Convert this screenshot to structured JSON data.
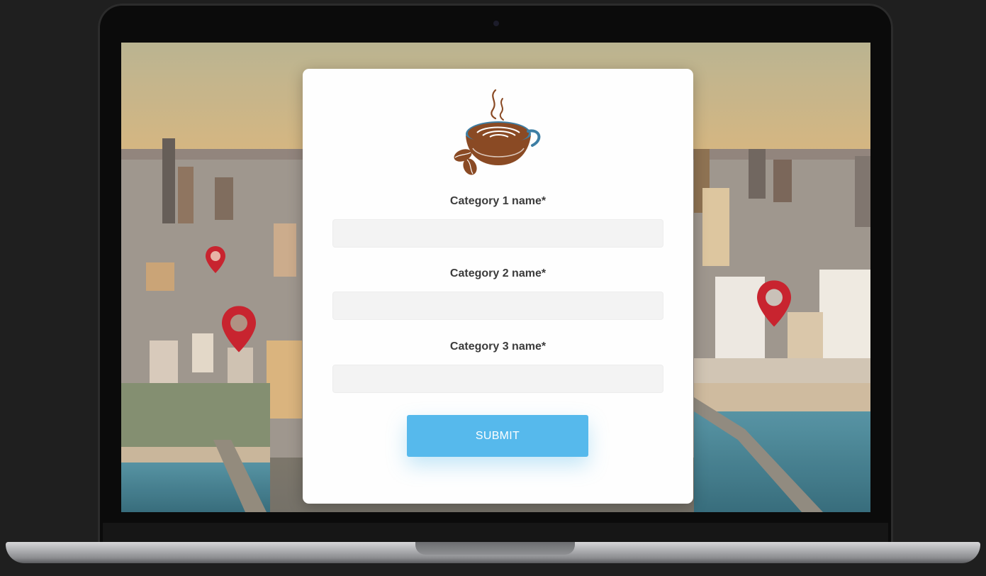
{
  "form": {
    "fields": [
      {
        "label": "Category 1 name*",
        "value": ""
      },
      {
        "label": "Category 2 name*",
        "value": ""
      },
      {
        "label": "Category 3 name*",
        "value": ""
      }
    ],
    "submit_label": "SUBMIT"
  },
  "icons": {
    "logo": "coffee-cup-logo",
    "pins": "map-pin-icon"
  },
  "colors": {
    "submit_button": "#56b9ec",
    "pin": "#c8242f",
    "coffee": "#8a4a24"
  }
}
